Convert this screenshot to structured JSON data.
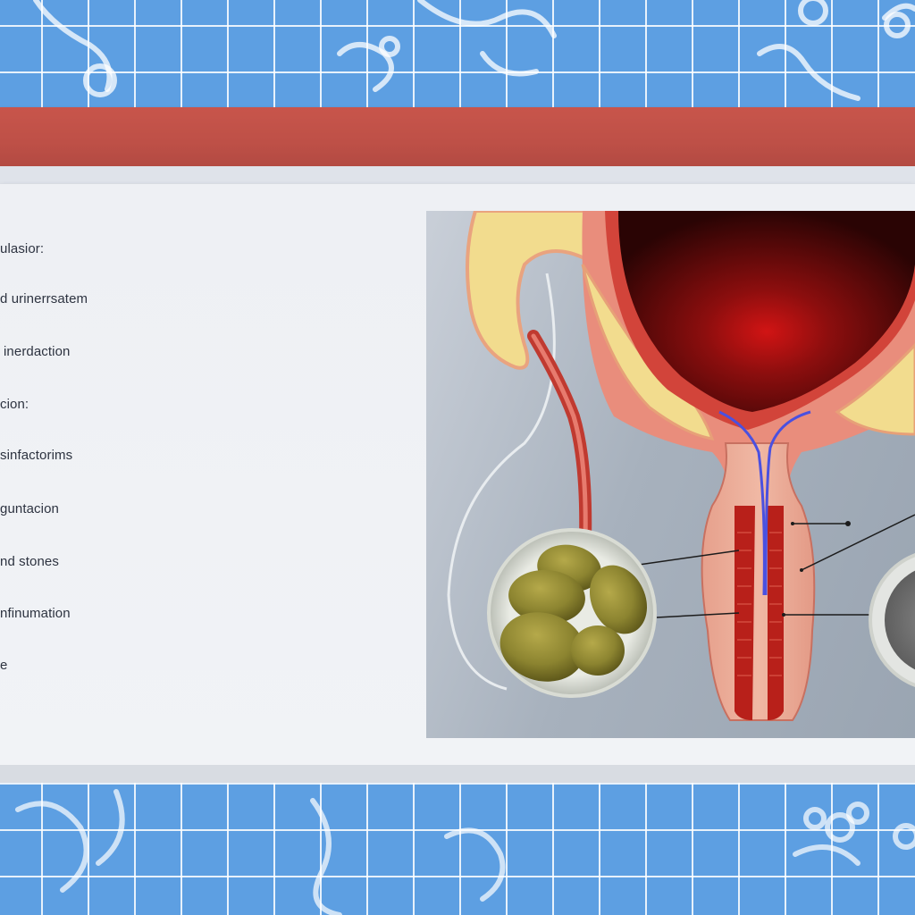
{
  "sidebar": {
    "items": [
      {
        "label": "ulasior:"
      },
      {
        "label": "d urinerrsatem"
      },
      {
        "label": "inerdaction"
      },
      {
        "label": "cion:"
      },
      {
        "label": "sinfactorims"
      },
      {
        "label": "guntacion"
      },
      {
        "label": "nd stones"
      },
      {
        "label": "nfinumation"
      },
      {
        "label": "e"
      }
    ]
  },
  "colors": {
    "header": "#be5047",
    "tile_blue": "#5d9fe2",
    "panel": "#eff1f5",
    "bladder_red": "#8b1010",
    "fat_yellow": "#f2dc8e",
    "stone_olive": "#8c8430"
  }
}
